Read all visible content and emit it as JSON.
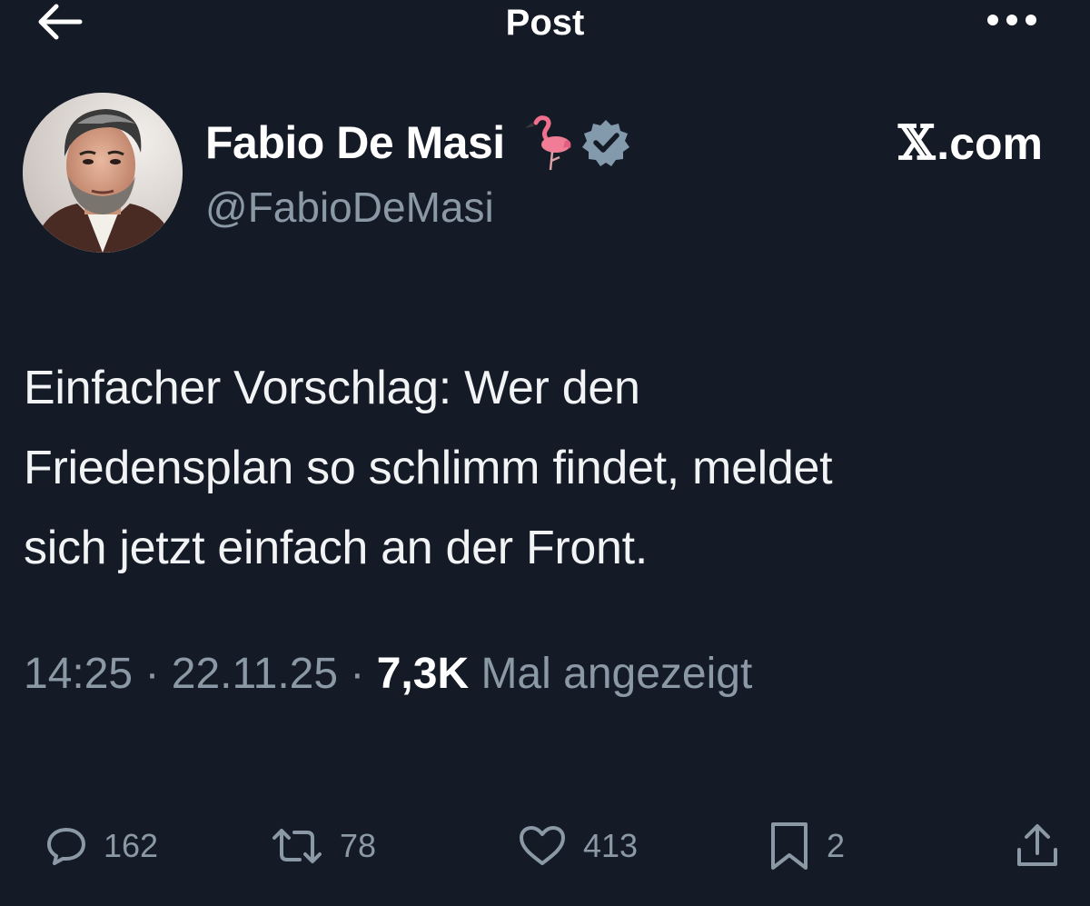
{
  "header": {
    "title": "Post",
    "back_icon": "arrow-left-icon",
    "more_icon": "more-horizontal-icon"
  },
  "author": {
    "name": "Fabio De Masi",
    "emoji_icon": "flamingo-icon",
    "verified_icon": "verified-badge-icon",
    "handle": "@FabioDeMasi"
  },
  "source": {
    "label": ".com",
    "logo_glyph": "𝕏"
  },
  "post": {
    "text": "Einfacher Vorschlag: Wer den\nFriedensplan so schlimm findet, meldet\nsich jetzt einfach an der Front."
  },
  "meta": {
    "time": "14:25",
    "separator": " · ",
    "date": "22.11.25",
    "views_count": "7,3K",
    "views_label": " Mal angezeigt"
  },
  "actions": {
    "reply": {
      "icon": "reply-icon",
      "count": "162"
    },
    "repost": {
      "icon": "repost-icon",
      "count": "78"
    },
    "like": {
      "icon": "heart-icon",
      "count": "413"
    },
    "bookmark": {
      "icon": "bookmark-icon",
      "count": "2"
    },
    "share": {
      "icon": "share-icon"
    }
  },
  "colors": {
    "background": "#151b26",
    "primary_text": "#ffffff",
    "secondary_text": "#8b98a5",
    "verified_badge": "#829aab"
  }
}
